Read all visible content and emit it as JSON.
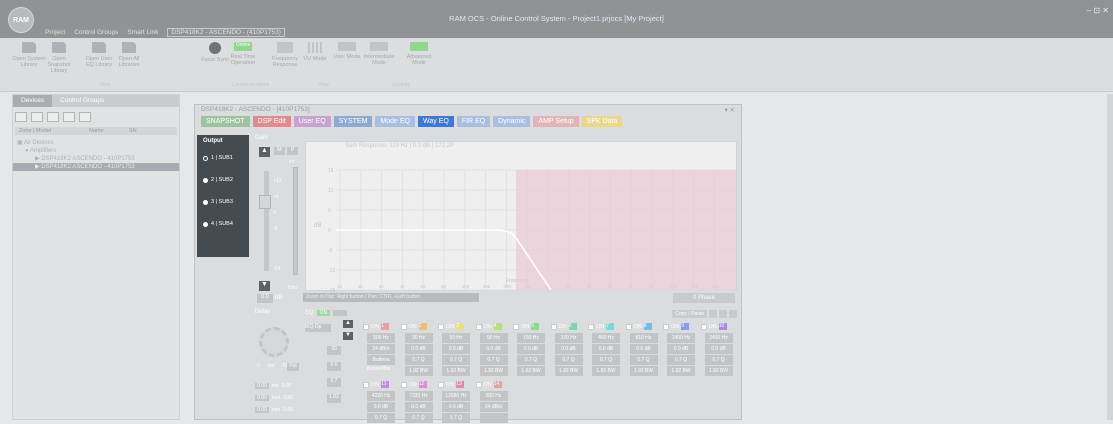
{
  "app": {
    "logo": "RAM",
    "title": "RAM OCS - Online Control System - Project1.prjocs [My Project]",
    "window_controls": "– ⊡ ✕"
  },
  "menu": [
    "Project",
    "Control Groups",
    "Smart Link",
    "DSP418K2 - ASCENDO - (410P1753)"
  ],
  "ribbon": {
    "buttons": [
      {
        "label": "Open System Library",
        "icon": "folder-icon"
      },
      {
        "label": "Open Snapshot Library",
        "icon": "folder-icon"
      },
      {
        "label": "Open User EQ Library",
        "icon": "folder-icon"
      },
      {
        "label": "Open All Libraries",
        "icon": "folder-icon"
      },
      {
        "label": "Force Sync",
        "icon": "sync-icon"
      },
      {
        "label": "Real Time Operation",
        "icon": "realtime-icon"
      },
      {
        "label": "Frequency Response",
        "icon": "freq-response-icon"
      },
      {
        "label": "VU Mode",
        "icon": "vu-meter-icon"
      },
      {
        "label": "User Mode",
        "icon": "user-mode-icon"
      },
      {
        "label": "Intermediate Mode",
        "icon": "intermediate-mode-icon"
      },
      {
        "label": "Advanced Mode",
        "icon": "advanced-mode-icon"
      }
    ],
    "groups": [
      "Files",
      "Communications",
      "View",
      "Security"
    ],
    "realtime_badge": "Online"
  },
  "left_panel": {
    "tabs": [
      "Devices",
      "Control Groups"
    ],
    "columns": [
      "Zone | Model",
      "Name",
      "SN"
    ],
    "tree": [
      "All Devices",
      "Amplifiers",
      "DSP418K2 ASCENDO - 410P1753",
      "DSP418K2 ASCENDO - 410P1753"
    ]
  },
  "dsp": {
    "title": "DSP418K2 - ASCENDO - [410P1753]",
    "pin": "▾ ✕",
    "tabs": [
      {
        "label": "SNAPSHOT",
        "color": "#9fc29f"
      },
      {
        "label": "DSP Edit",
        "color": "#e58a8a"
      },
      {
        "label": "User EQ",
        "color": "#c9a3cf"
      },
      {
        "label": "SYSTEM",
        "color": "#8ea9d2"
      },
      {
        "label": "Mode EQ",
        "color": "#a9bfe0"
      },
      {
        "label": "Way EQ",
        "color": "#3c78d8"
      },
      {
        "label": "FIR EQ",
        "color": "#a9bfe0"
      },
      {
        "label": "Dynamic",
        "color": "#a9bfe0"
      },
      {
        "label": "AMP Setup",
        "color": "#e4b4b4"
      },
      {
        "label": "SPK Data",
        "color": "#e9d88a"
      }
    ],
    "output": {
      "header": "Output",
      "channels": [
        "1 | SUB1",
        "2 | SUB2",
        "3 | SUB3",
        "4 | SUB4"
      ]
    },
    "gain": {
      "label": "Gain",
      "value": "0.0",
      "unit": "dB",
      "scale": [
        "+12",
        "+6",
        "0",
        "-6",
        "-24"
      ],
      "ch_labels": [
        "M",
        "P"
      ],
      "mute_label": "-Inf",
      "trim_label": "Trim"
    },
    "graph": {
      "title": "Sum Response: 119 Hz | 0.0 dB | 172.2P",
      "ylabels": [
        "18",
        "12",
        "6",
        "0",
        "-6",
        "-12",
        "-18"
      ],
      "xlabels": [
        "10",
        "20",
        "30",
        "40",
        "50",
        "60",
        "100",
        "200",
        "300",
        "400",
        "600",
        "1k",
        "2k",
        "3k",
        "4k",
        "6k",
        "10k",
        "15k",
        "20k"
      ],
      "ylabel": "dB",
      "xlabel": "Frequency",
      "zoom_tip": "Zoom In/Out: Right button / Pan: CTRL +Left button",
      "phase_button": "0 Phase"
    },
    "delay": {
      "label": "Delay",
      "ms": "0.00",
      "ms_u": "ms",
      "feet": "0.00",
      "feet_u": "feet",
      "mm": "0.00",
      "mm_u": "mm",
      "values_r": [
        "0.00",
        "0.00",
        "0.00"
      ],
      "knob_min": "0",
      "knob_mid": "ms",
      "knob_max": "51",
      "reset": "Rst"
    },
    "eq": {
      "label": "EQ",
      "on": "ON",
      "copy_paste": "Copy / Paste",
      "filter_type": "Bessel/Bw",
      "type_select": "BiQ-Dp",
      "freq_input": "30",
      "gain_input": "0.0",
      "q_input": "0.7",
      "bw_input": "1.82",
      "bands_row1": [
        {
          "n": "1",
          "color": "#e6a0a0",
          "f": "500 Hz",
          "g": "24 dB/o",
          "q": "Butterw"
        },
        {
          "n": "2",
          "color": "#e6c07a",
          "f": "30 Hz",
          "g": "0.0 dB",
          "q": "0.7 Q",
          "bw": "1.92 BW"
        },
        {
          "n": "3",
          "color": "#e6e27a",
          "f": "50 Hz",
          "g": "0.0 dB",
          "q": "0.7 Q",
          "bw": "1.92 BW"
        },
        {
          "n": "4",
          "color": "#b8e07a",
          "f": "90 Hz",
          "g": "0.0 dB",
          "q": "0.7 Q",
          "bw": "1.92 BW"
        },
        {
          "n": "5",
          "color": "#8fd88f",
          "f": "150 Hz",
          "g": "0.0 dB",
          "q": "0.7 Q",
          "bw": "1.92 BW"
        },
        {
          "n": "6",
          "color": "#7ad8b0",
          "f": "270 Hz",
          "g": "0.0 dB",
          "q": "0.7 Q",
          "bw": "1.92 BW"
        },
        {
          "n": "7",
          "color": "#7ad8d8",
          "f": "460 Hz",
          "g": "0.0 dB",
          "q": "0.7 Q",
          "bw": "1.92 BW"
        },
        {
          "n": "8",
          "color": "#7ab8e6",
          "f": "810 Hz",
          "g": "0.0 dB",
          "q": "0.7 Q",
          "bw": "1.92 BW"
        },
        {
          "n": "9",
          "color": "#8a9de6",
          "f": "1400 Hz",
          "g": "0.0 dB",
          "q": "0.7 Q",
          "bw": "1.92 BW"
        },
        {
          "n": "10",
          "color": "#a88ae6",
          "f": "2430 Hz",
          "g": "0.0 dB",
          "q": "0.7 Q",
          "bw": "1.92 BW"
        }
      ],
      "bands_row2": [
        {
          "n": "11",
          "color": "#c48ae6",
          "f": "4220 Hz",
          "g": "0.0 dB",
          "q": "0.7 Q"
        },
        {
          "n": "12",
          "color": "#e08ad8",
          "f": "7320 Hz",
          "g": "0.0 dB",
          "q": "0.7 Q"
        },
        {
          "n": "13",
          "color": "#e08aa8",
          "f": "12680 Hz",
          "g": "0.0 dB",
          "q": "0.7 Q"
        },
        {
          "n": "14",
          "color": "#e6a0a0",
          "f": "500 Hz",
          "g": "24 dB/o",
          "q": ""
        }
      ]
    }
  }
}
